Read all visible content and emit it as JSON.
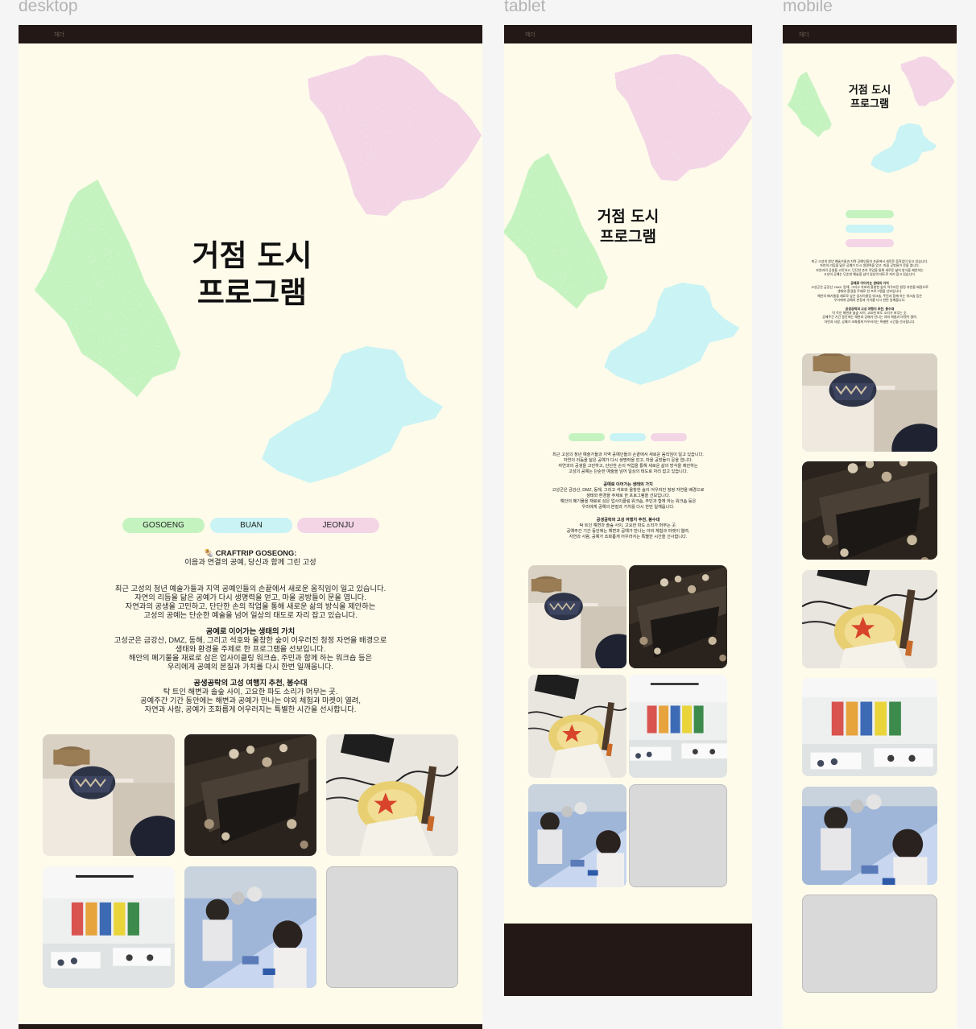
{
  "frames": {
    "desktop": {
      "label": "desktop"
    },
    "tablet": {
      "label": "tablet"
    },
    "mobile": {
      "label": "mobile"
    }
  },
  "header": {
    "label": "헤더"
  },
  "hero": {
    "title_line1": "거점 도시",
    "title_line2": "프로그램"
  },
  "cities": [
    "GOSOENG",
    "BUAN",
    "JEONJU"
  ],
  "intro": {
    "heading": "🌯 CRAFTRIP GOSEONG:",
    "subheading": "이음과 연결의 공예, 당신과 함께 그린 고성"
  },
  "paragraphs": [
    {
      "title": "",
      "body": "최근 고성의 청년 예술가들과 지역 공예인들의 손끝에서 새로운 움직임이 일고 있습니다.\n자연의 리듬을 닮은 공예가 다시 생명력을 얻고, 마을 공방들이 문을 엽니다.\n자연과의 공생을 고민하고, 단단한 손의 작업을 통해 새로운 삶의 방식을 제안하는\n고성의 공예는 단순한 예술을 넘어 일상의 태도로 자리 잡고 있습니다."
    },
    {
      "title": "공예로 이어가는 생태의 가치",
      "body": "고성군은 금강산, DMZ, 동해, 그리고 석호와 울창한 숲이 어우러진 청정 자연을 배경으로\n생태와 환경을 주제로 한 프로그램을 선보입니다.\n해안의 폐기물을 재료로 삼은 업사이클링 워크숍, 주민과 함께 하는 워크숍 등은\n우리에게 공예의 본질과 가치를 다시 한번 일깨웁니다."
    },
    {
      "title": "공생공락의 고성 여행지 추천, 봉수대",
      "body": "탁 트인 해변과 솔숲 사이, 고요한 파도 소리가 머무는 곳.\n공예주간 기간 동안에는 해변과 공예가 만나는 야외 체험과 마켓이 열려,\n자연과 사람, 공예가 조화롭게 어우러지는 특별한 시간을 선사합니다."
    }
  ],
  "gallery": [
    {
      "name": "bowl-on-pedestal-photo"
    },
    {
      "name": "night-gathering-photo"
    },
    {
      "name": "painting-vase-photo"
    },
    {
      "name": "exhibition-hall-photo"
    },
    {
      "name": "outdoor-workshop-photo"
    },
    {
      "name": "empty-placeholder"
    }
  ],
  "colors": {
    "background": "#fefbeb",
    "header": "#231815",
    "green": "#c5f3c0",
    "cyan": "#c9f3f4",
    "pink": "#f3d5e6"
  }
}
